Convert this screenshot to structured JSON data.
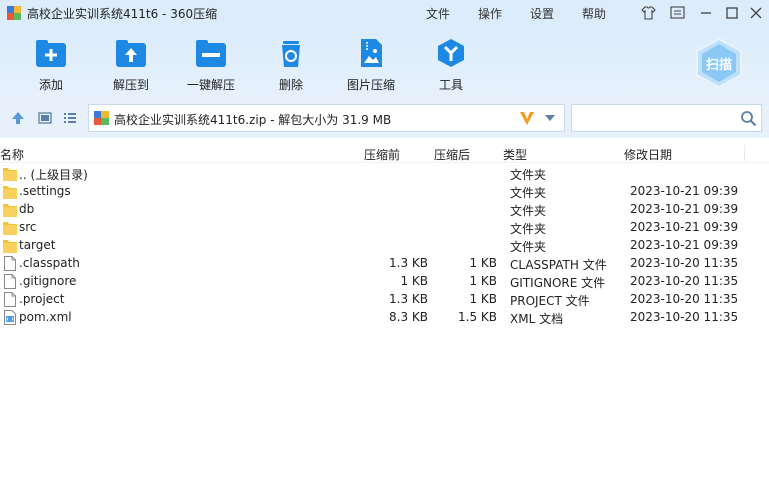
{
  "window": {
    "title": "高校企业实训系统411t6 - 360压缩",
    "menu": [
      "文件",
      "操作",
      "设置",
      "帮助"
    ]
  },
  "toolbar": {
    "buttons": [
      {
        "label": "添加",
        "icon": "add-icon"
      },
      {
        "label": "解压到",
        "icon": "extract-to-icon"
      },
      {
        "label": "一键解压",
        "icon": "one-click-extract-icon"
      },
      {
        "label": "删除",
        "icon": "delete-icon"
      },
      {
        "label": "图片压缩",
        "icon": "image-compress-icon"
      },
      {
        "label": "工具",
        "icon": "tools-icon"
      }
    ],
    "scan_label": "扫描"
  },
  "address": {
    "path": "高校企业实训系统411t6.zip - 解包大小为 31.9 MB",
    "search_placeholder": ""
  },
  "columns": {
    "name": "名称",
    "packed": "压缩前",
    "compressed": "压缩后",
    "type": "类型",
    "modified": "修改日期"
  },
  "files": [
    {
      "name": ".. (上级目录)",
      "packed": "",
      "compressed": "",
      "type": "文件夹",
      "modified": "",
      "kind": "folder"
    },
    {
      "name": ".settings",
      "packed": "",
      "compressed": "",
      "type": "文件夹",
      "modified": "2023-10-21 09:39",
      "kind": "folder"
    },
    {
      "name": "db",
      "packed": "",
      "compressed": "",
      "type": "文件夹",
      "modified": "2023-10-21 09:39",
      "kind": "folder"
    },
    {
      "name": "src",
      "packed": "",
      "compressed": "",
      "type": "文件夹",
      "modified": "2023-10-21 09:39",
      "kind": "folder"
    },
    {
      "name": "target",
      "packed": "",
      "compressed": "",
      "type": "文件夹",
      "modified": "2023-10-21 09:39",
      "kind": "folder"
    },
    {
      "name": ".classpath",
      "packed": "1.3 KB",
      "compressed": "1 KB",
      "type": "CLASSPATH 文件",
      "modified": "2023-10-20 11:35",
      "kind": "file"
    },
    {
      "name": ".gitignore",
      "packed": "1 KB",
      "compressed": "1 KB",
      "type": "GITIGNORE 文件",
      "modified": "2023-10-20 11:35",
      "kind": "file"
    },
    {
      "name": ".project",
      "packed": "1.3 KB",
      "compressed": "1 KB",
      "type": "PROJECT 文件",
      "modified": "2023-10-20 11:35",
      "kind": "file"
    },
    {
      "name": "pom.xml",
      "packed": "8.3 KB",
      "compressed": "1.5 KB",
      "type": "XML 文档",
      "modified": "2023-10-20 11:35",
      "kind": "xml"
    }
  ],
  "colors": {
    "accent": "#1e88e5",
    "folder": "#f5c33b",
    "titlebar_bg": "#dcecfb"
  }
}
